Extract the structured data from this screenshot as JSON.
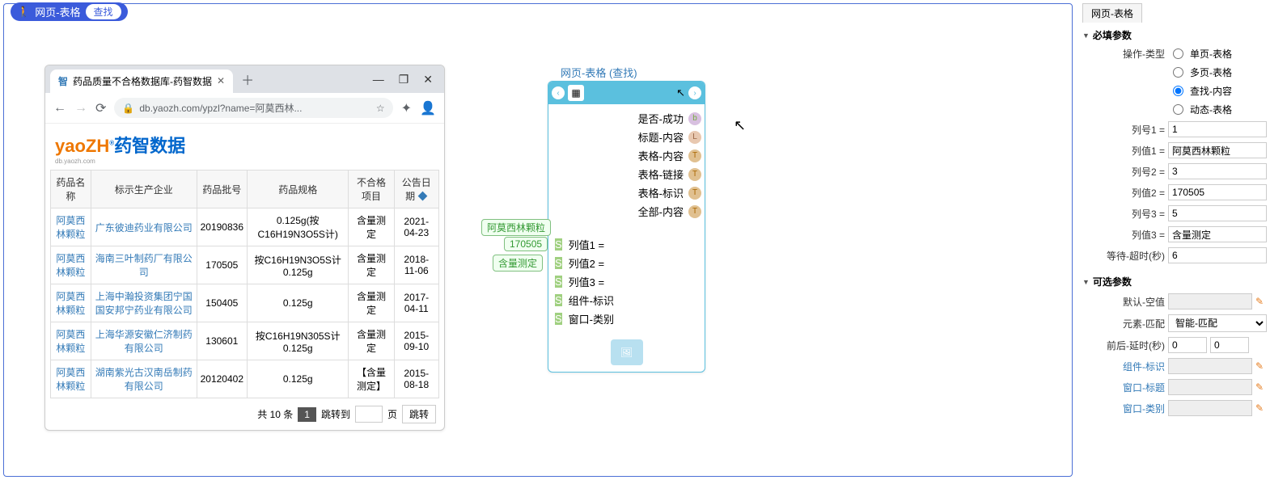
{
  "title_bar": {
    "title": "网页-表格",
    "find": "查找"
  },
  "browser": {
    "tab_title": "药品质量不合格数据库-药智数据",
    "url": "db.yaozh.com/ypzl?name=阿莫西林...",
    "logo_main": "药智数据",
    "logo_prefix": "yaoZH",
    "logo_sub": "db.yaozh.com",
    "headers": [
      "药品名称",
      "标示生产企业",
      "药品批号",
      "药品规格",
      "不合格项目",
      "公告日期"
    ],
    "rows": [
      {
        "name": "阿莫西林颗粒",
        "company": "广东彼迪药业有限公司",
        "batch": "20190836",
        "spec": "0.125g(按C16H19N3O5S计)",
        "item": "含量测定",
        "date": "2021-04-23"
      },
      {
        "name": "阿莫西林颗粒",
        "company": "海南三叶制药厂有限公司",
        "batch": "170505",
        "spec": "按C16H19N3O5S计0.125g",
        "item": "含量测定",
        "date": "2018-11-06"
      },
      {
        "name": "阿莫西林颗粒",
        "company": "上海中瀚投资集团宁国国安邦宁药业有限公司",
        "batch": "150405",
        "spec": "0.125g",
        "item": "含量测定",
        "date": "2017-04-11"
      },
      {
        "name": "阿莫西林颗粒",
        "company": "上海华源安徽仁济制药有限公司",
        "batch": "130601",
        "spec": "按C16H19N305S计0.125g",
        "item": "含量测定",
        "date": "2015-09-10"
      },
      {
        "name": "阿莫西林颗粒",
        "company": "湖南紫光古汉南岳制药有限公司",
        "batch": "20120402",
        "spec": "0.125g",
        "item": "【含量测定】",
        "date": "2015-08-18"
      }
    ],
    "paginator": {
      "total": "共 10 条",
      "page": "1",
      "jump_to": "跳转到",
      "page_unit": "页",
      "jump": "跳转"
    }
  },
  "node": {
    "title": "网页-表格 (查找)",
    "outputs": [
      {
        "label": "是否-成功",
        "badge": "b"
      },
      {
        "label": "标题-内容",
        "badge": "L"
      },
      {
        "label": "表格-内容",
        "badge": "T"
      },
      {
        "label": "表格-链接",
        "badge": "T"
      },
      {
        "label": "表格-标识",
        "badge": "T"
      },
      {
        "label": "全部-内容",
        "badge": "T"
      }
    ],
    "inputs": [
      {
        "label": "列值1 =",
        "chip": "阿莫西林颗粒"
      },
      {
        "label": "列值2 =",
        "chip": "170505"
      },
      {
        "label": "列值3 =",
        "chip": "含量测定"
      },
      {
        "label": "组件-标识",
        "chip": ""
      },
      {
        "label": "窗口-类别",
        "chip": ""
      }
    ]
  },
  "right": {
    "tab": "网页-表格",
    "required": "必填参数",
    "optional": "可选参数",
    "op_type_label": "操作-类型",
    "op_types": [
      "单页-表格",
      "多页-表格",
      "查找-内容",
      "动态-表格"
    ],
    "op_type_selected": 2,
    "fields": [
      {
        "label": "列号1 =",
        "value": "1"
      },
      {
        "label": "列值1 =",
        "value": "阿莫西林颗粒"
      },
      {
        "label": "列号2 =",
        "value": "3"
      },
      {
        "label": "列值2 =",
        "value": "170505"
      },
      {
        "label": "列号3 =",
        "value": "5"
      },
      {
        "label": "列值3 =",
        "value": "含量测定"
      },
      {
        "label": "等待-超时(秒)",
        "value": "6"
      }
    ],
    "opt_default_empty": "默认-空值",
    "opt_element_match": {
      "label": "元素-匹配",
      "value": "智能-匹配"
    },
    "opt_delay": {
      "label": "前后-延时(秒)",
      "v1": "0",
      "v2": "0"
    },
    "opt_links": [
      {
        "label": "组件-标识"
      },
      {
        "label": "窗口-标题"
      },
      {
        "label": "窗口-类别"
      }
    ]
  }
}
